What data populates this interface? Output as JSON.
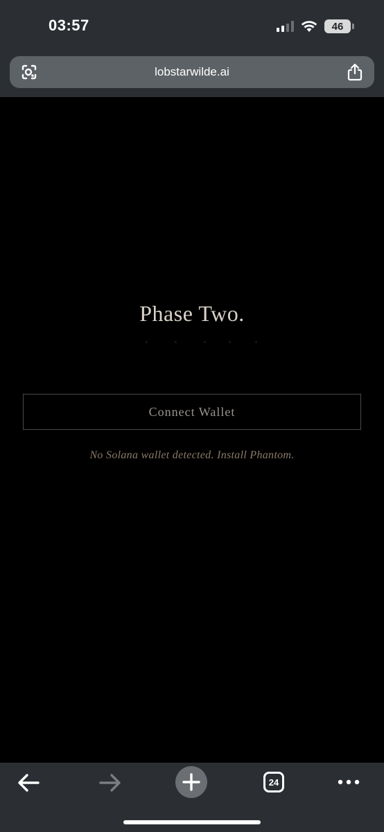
{
  "status_bar": {
    "time": "03:57",
    "battery_level": "46",
    "signal_bars": 2,
    "icons": [
      "cellular-signal-icon",
      "wifi-icon",
      "battery-icon"
    ]
  },
  "browser": {
    "url": "lobstarwilde.ai",
    "icons": [
      "lens-icon",
      "share-icon"
    ],
    "tab_count": "24",
    "toolbar_icons": [
      "back-arrow-icon",
      "forward-arrow-icon",
      "plus-icon",
      "tabs-icon",
      "more-icon"
    ]
  },
  "page": {
    "title": "Phase Two.",
    "connect_button_label": "Connect Wallet",
    "wallet_message": "No Solana wallet detected. Install Phantom."
  },
  "colors": {
    "chrome_background": "#2b2f33",
    "urlbar_background": "#5d6266",
    "page_background": "#000000",
    "title_text": "#d8d2c8",
    "button_text": "#9a958e",
    "message_text": "#8a7a68"
  }
}
